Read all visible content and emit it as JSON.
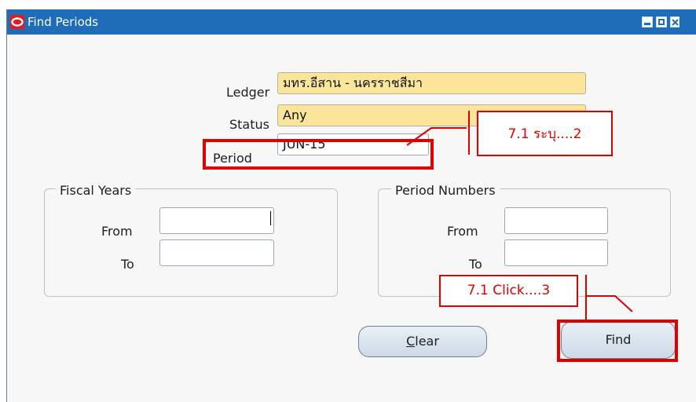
{
  "window": {
    "title": "Find Periods",
    "titlebar_color": "#1f6db8",
    "app_icon": "oracle-icon",
    "controls": [
      "minimize-icon",
      "maximize-icon",
      "close-icon"
    ]
  },
  "form": {
    "ledger": {
      "label": "Ledger",
      "value": "มทร.อีสาน - นครราชสีมา"
    },
    "status": {
      "label": "Status",
      "value": "Any"
    },
    "period": {
      "label": "Period",
      "value": "JUN-15"
    },
    "required_field_color": "#fbe59a"
  },
  "fiscal_years": {
    "title": "Fiscal Years",
    "from_label": "From",
    "from_value": "",
    "to_label": "To",
    "to_value": ""
  },
  "period_numbers": {
    "title": "Period Numbers",
    "from_label": "From",
    "from_value": "",
    "to_label": "To",
    "to_value": ""
  },
  "buttons": {
    "clear_label": "Clear",
    "clear_accelerator": "C",
    "clear_rest": "lear",
    "find_label": "Find"
  },
  "annotations": {
    "callout_period": "7.1 ระบุ....2",
    "callout_find": "7.1 Click....3",
    "highlight_color": "#e00000"
  }
}
